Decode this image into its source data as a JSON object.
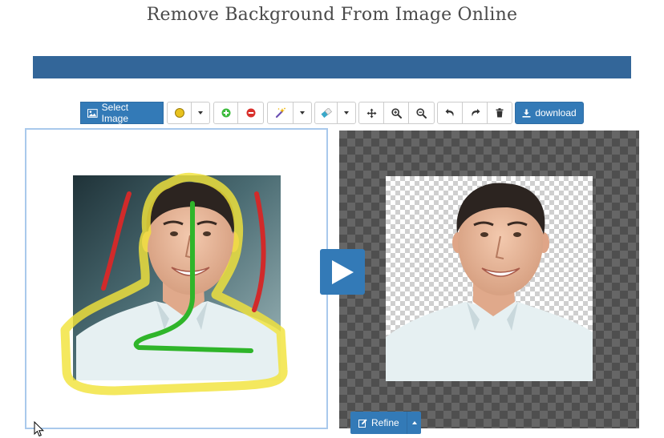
{
  "page": {
    "title": "Remove Background From Image Online"
  },
  "toolbar": {
    "select_image_label": "Select Image",
    "download_label": "download",
    "icons": [
      "image-icon",
      "brush-size-dot-icon",
      "add-circle-icon",
      "remove-circle-icon",
      "magic-wand-icon",
      "eraser-icon",
      "move-arrows-icon",
      "zoom-in-icon",
      "zoom-out-icon",
      "undo-icon",
      "redo-icon",
      "trash-icon",
      "download-icon"
    ]
  },
  "refine": {
    "label": "Refine"
  },
  "colors": {
    "primary": "#337ab7",
    "banner": "#336699",
    "brush_yellow": "#f2e33a",
    "keep_green": "#2fb52a",
    "remove_red": "#d12a2a",
    "add_button_green": "#3dbb3d",
    "remove_button_red": "#d9302c"
  }
}
